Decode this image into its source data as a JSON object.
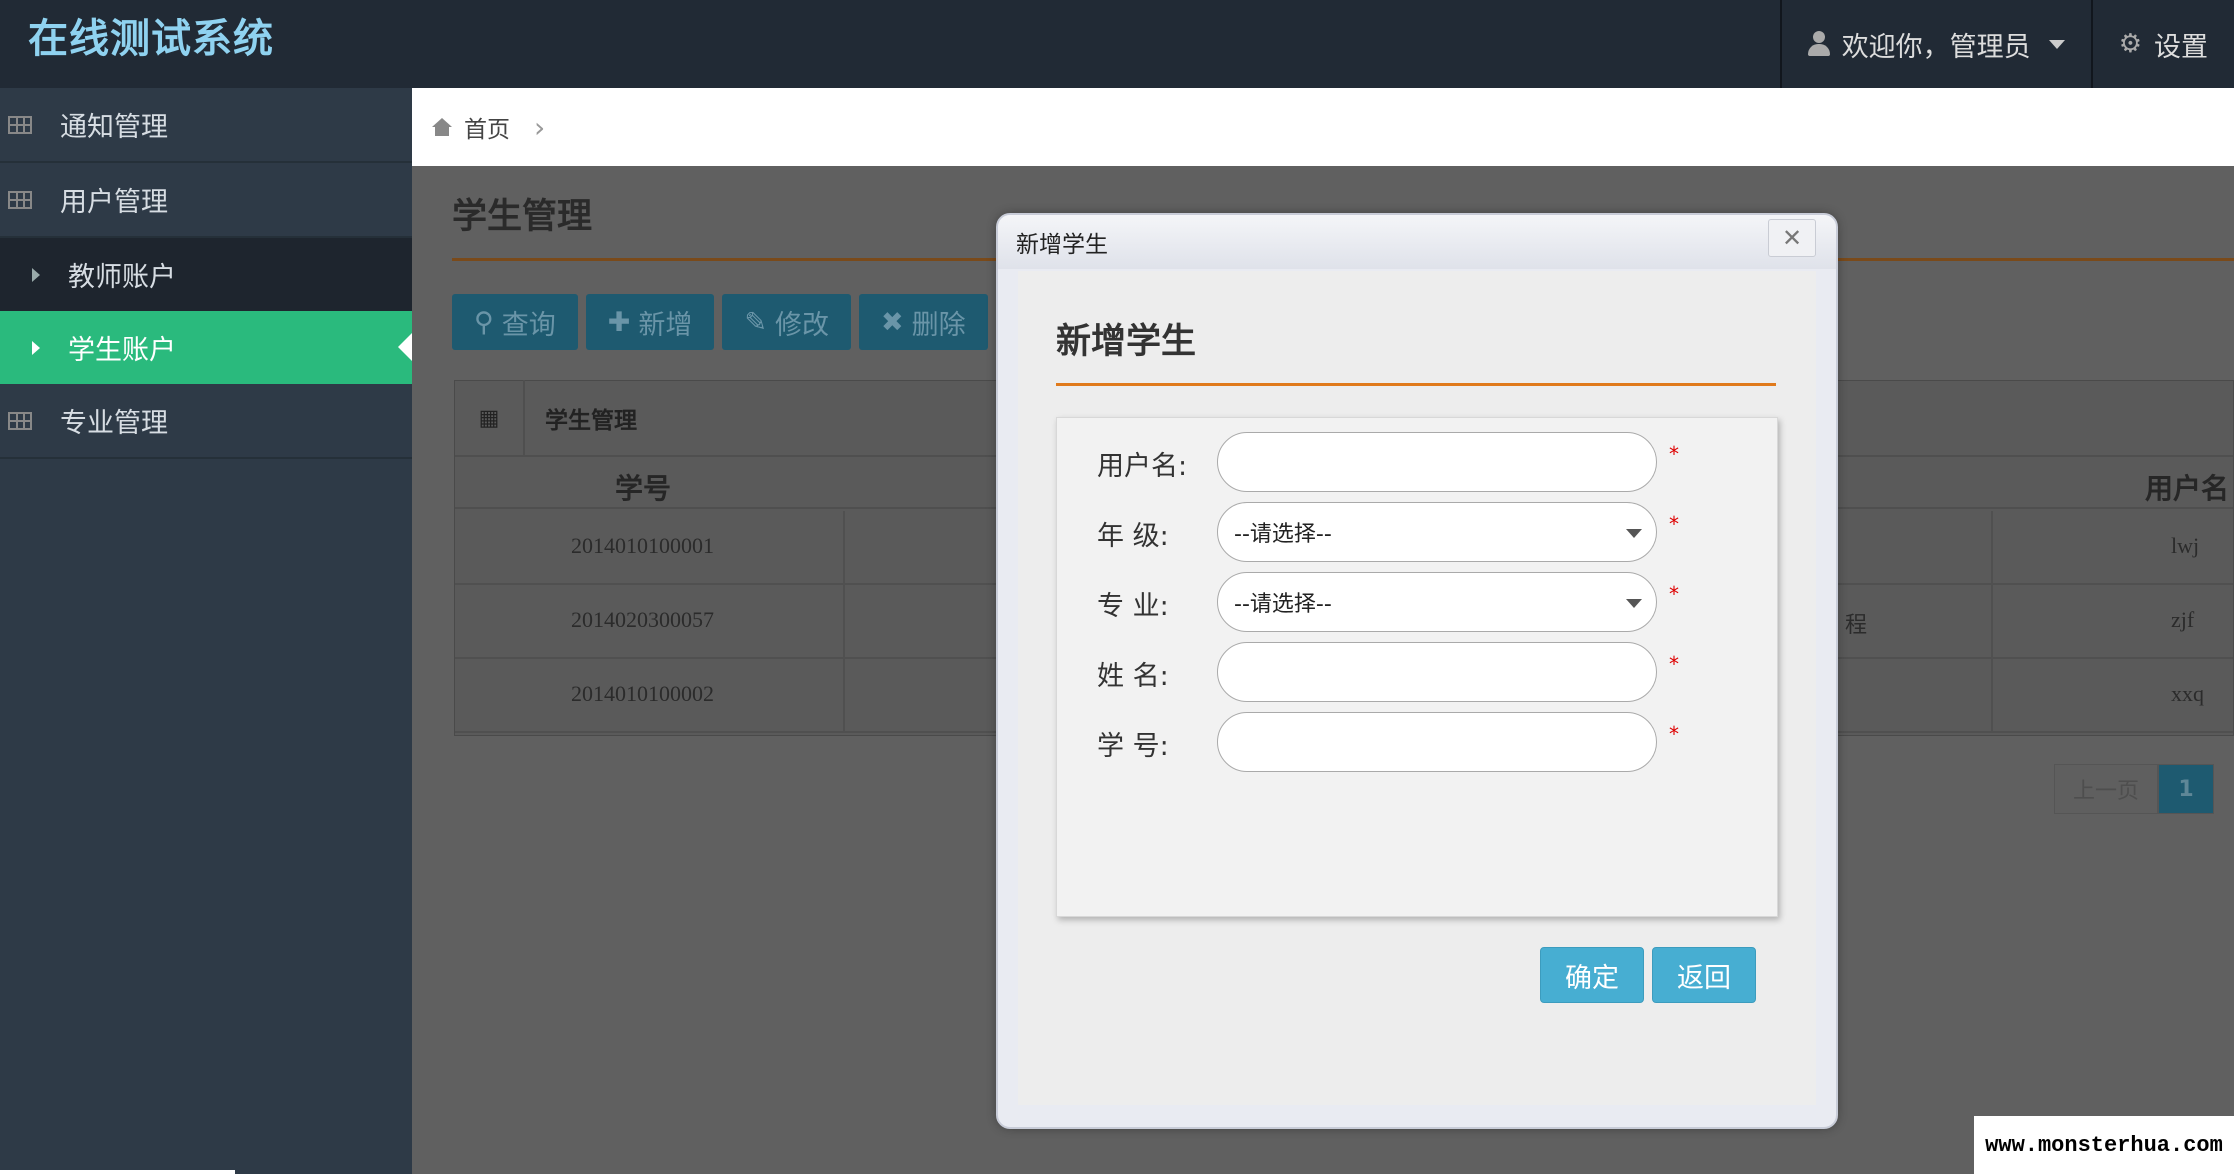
{
  "header": {
    "brand": "在线测试系统",
    "user_menu": "欢迎你，管理员",
    "settings": "设置"
  },
  "sidebar": {
    "items": [
      {
        "label": "通知管理"
      },
      {
        "label": "用户管理"
      },
      {
        "label": "教师账户"
      },
      {
        "label": "学生账户"
      },
      {
        "label": "专业管理"
      }
    ]
  },
  "breadcrumb": {
    "home": "首页"
  },
  "page": {
    "title": "学生管理",
    "toolbar": {
      "query": "查询",
      "add": "新增",
      "edit": "修改",
      "delete": "删除"
    },
    "grid": {
      "title": "学生管理",
      "columns": [
        "学号",
        "用户名"
      ],
      "rows": [
        {
          "id": "2014010100001",
          "mid": "",
          "user": "lwj"
        },
        {
          "id": "2014020300057",
          "mid": "程",
          "user": "zjf"
        },
        {
          "id": "2014010100002",
          "mid": "",
          "user": "xxq"
        }
      ]
    },
    "pager": {
      "prev": "上一页",
      "current": "1"
    }
  },
  "modal": {
    "header": "新增学生",
    "title": "新增学生",
    "fields": [
      {
        "label": "用户名:",
        "value": "",
        "required": "*"
      },
      {
        "label": "年 级:",
        "value": "--请选择--",
        "required": "*"
      },
      {
        "label": "专 业:",
        "value": "--请选择--",
        "required": "*"
      },
      {
        "label": "姓 名:",
        "value": "",
        "required": "*"
      },
      {
        "label": "学 号:",
        "value": "",
        "required": "*"
      }
    ],
    "confirm": "确定",
    "back": "返回"
  },
  "watermark": "www.monsterhua.com",
  "colors": {
    "sidebar_active": "#2aba7d",
    "accent_line": "#e07a1c",
    "button": "#47aed2",
    "brand": "#8fd2f0"
  }
}
